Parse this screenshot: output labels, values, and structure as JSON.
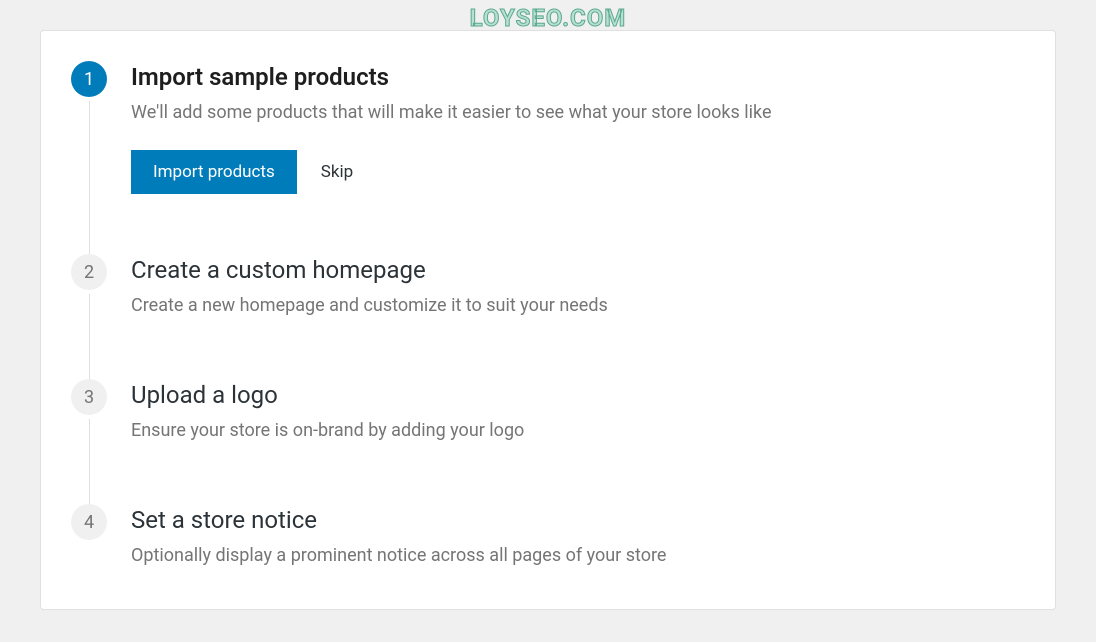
{
  "watermark": "LOYSEO.COM",
  "steps": [
    {
      "number": "1",
      "title": "Import sample products",
      "description": "We'll add some products that will make it easier to see what your store looks like",
      "active": true,
      "primaryButton": "Import products",
      "secondaryButton": "Skip"
    },
    {
      "number": "2",
      "title": "Create a custom homepage",
      "description": "Create a new homepage and customize it to suit your needs",
      "active": false
    },
    {
      "number": "3",
      "title": "Upload a logo",
      "description": "Ensure your store is on-brand by adding your logo",
      "active": false
    },
    {
      "number": "4",
      "title": "Set a store notice",
      "description": "Optionally display a prominent notice across all pages of your store",
      "active": false
    }
  ]
}
